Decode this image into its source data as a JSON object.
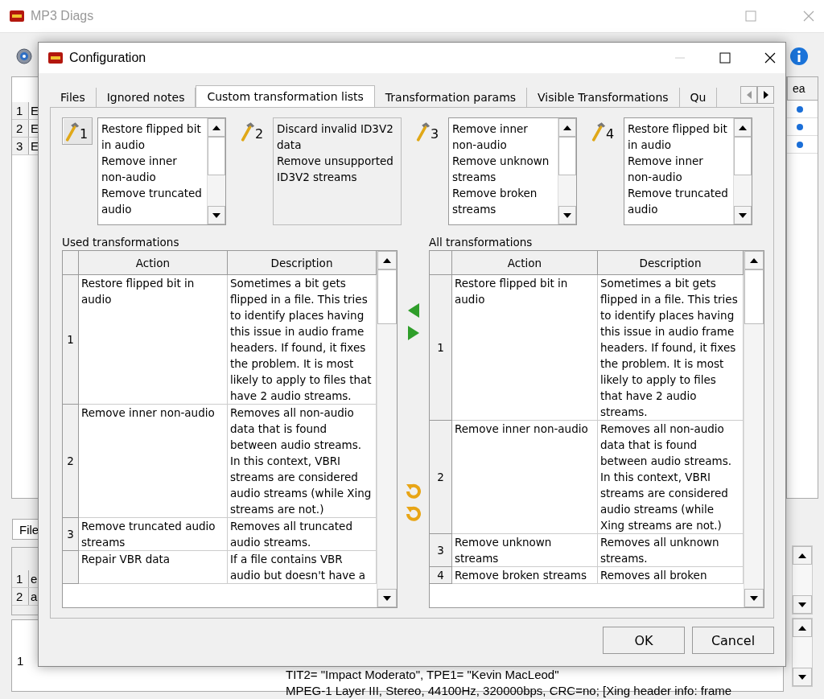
{
  "main_window": {
    "title": "MP3 Diags",
    "left_header": "ea",
    "left_rows": [
      {
        "number": "1",
        "cell": "E"
      },
      {
        "number": "2",
        "cell": "E"
      },
      {
        "number": "3",
        "cell": "E"
      }
    ],
    "lower_tab": "File",
    "lower_rows": [
      {
        "number": "1",
        "cell": "e"
      },
      {
        "number": "2",
        "cell": "a"
      }
    ],
    "details_row": "1",
    "details_lines": [
      "TIT2= \"Impact Moderato\", TPE1= \"Kevin MacLeod\"",
      "MPEG-1 Layer III, Stereo, 44100Hz, 320000bps, CRC=no; [Xing header info: frame"
    ]
  },
  "dialog": {
    "title": "Configuration",
    "tabs": [
      {
        "label": "Files",
        "selected": false
      },
      {
        "label": "Ignored notes",
        "selected": false
      },
      {
        "label": "Custom transformation lists",
        "selected": true
      },
      {
        "label": "Transformation params",
        "selected": false
      },
      {
        "label": "Visible Transformations",
        "selected": false
      },
      {
        "label": "Qu",
        "selected": false
      }
    ],
    "lists": [
      {
        "number": "1",
        "selected": true,
        "scrollbar": true,
        "items": [
          "Restore flipped bit in audio",
          "Remove inner non-audio",
          "Remove truncated audio"
        ]
      },
      {
        "number": "2",
        "selected": false,
        "scrollbar": false,
        "items": [
          "Discard invalid ID3V2 data",
          "Remove unsupported ID3V2 streams"
        ]
      },
      {
        "number": "3",
        "selected": false,
        "scrollbar": true,
        "items": [
          "Remove inner non-audio",
          "Remove unknown streams",
          "Remove broken streams"
        ]
      },
      {
        "number": "4",
        "selected": false,
        "scrollbar": true,
        "items": [
          "Restore flipped bit in audio",
          "Remove inner non-audio",
          "Remove truncated audio"
        ]
      }
    ],
    "used": {
      "label": "Used transformations",
      "columns": [
        "Action",
        "Description"
      ],
      "rows": [
        {
          "number": "1",
          "action": "Restore flipped bit in audio",
          "description": "Sometimes a bit gets flipped in a file. This tries to identify places having this issue in audio frame headers. If found, it fixes the problem. It is most likely to apply to files that have 2 audio streams."
        },
        {
          "number": "2",
          "action": "Remove inner non-audio",
          "description": "Removes all non-audio data that is found between audio streams. In this context, VBRI streams are considered audio streams (while Xing streams are not.)"
        },
        {
          "number": "3",
          "action": "Remove truncated audio streams",
          "description": "Removes all truncated audio streams."
        },
        {
          "action": "Repair VBR data",
          "description": "If a file contains VBR audio but doesn't have a"
        }
      ]
    },
    "all": {
      "label": "All transformations",
      "columns": [
        "Action",
        "Description"
      ],
      "rows": [
        {
          "number": "1",
          "action": "Restore flipped bit in audio",
          "description": "Sometimes a bit gets flipped in a file. This tries to identify places having this issue in audio frame headers. If found, it fixes the problem. It is most likely to apply to files that have 2 audio streams."
        },
        {
          "number": "2",
          "action": "Remove inner non-audio",
          "description": "Removes all non-audio data that is found between audio streams. In this context, VBRI streams are considered audio streams (while Xing streams are not.)"
        },
        {
          "number": "3",
          "action": "Remove unknown streams",
          "description": "Removes all unknown streams."
        },
        {
          "number": "4",
          "action": "Remove broken streams",
          "description": "Removes all broken"
        }
      ]
    },
    "buttons": [
      "OK",
      "Cancel"
    ]
  }
}
